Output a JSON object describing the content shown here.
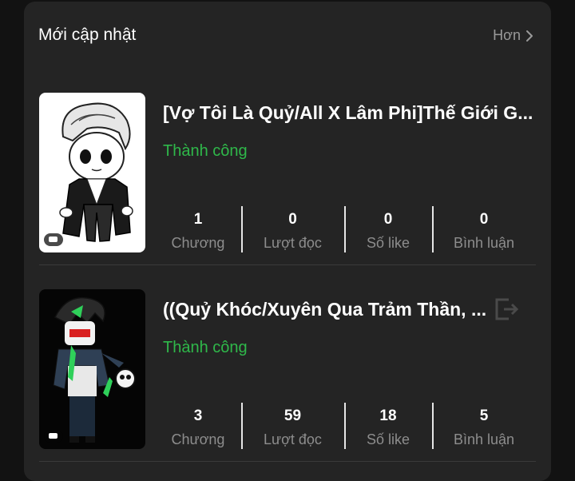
{
  "section": {
    "title": "Mới cập nhật",
    "more_label": "Hơn"
  },
  "stories": [
    {
      "title": "[Vợ Tôi Là Quỷ/All X Lâm Phi]Thế Giới G...",
      "status": "Thành công",
      "stats": [
        {
          "value": "1",
          "label": "Chương"
        },
        {
          "value": "0",
          "label": "Lượt đọc"
        },
        {
          "value": "0",
          "label": "Số like"
        },
        {
          "value": "0",
          "label": "Bình luận"
        }
      ]
    },
    {
      "title": "((Quỷ Khóc/Xuyên Qua Trảm Thần, ...",
      "status": "Thành công",
      "stats": [
        {
          "value": "3",
          "label": "Chương"
        },
        {
          "value": "59",
          "label": "Lượt đọc"
        },
        {
          "value": "18",
          "label": "Số like"
        },
        {
          "value": "5",
          "label": "Bình luận"
        }
      ]
    }
  ],
  "colors": {
    "panel": "#242424",
    "status_green": "#2fb84a",
    "muted": "#8d8d8d"
  },
  "icons": [
    "chevron-right-icon",
    "chat-bubble-icon",
    "exit-icon"
  ]
}
